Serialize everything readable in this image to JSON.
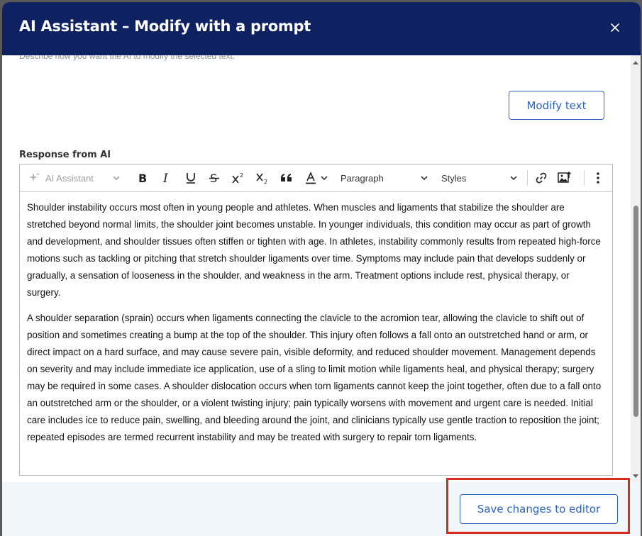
{
  "modal": {
    "title": "AI Assistant – Modify with a prompt",
    "hint": "Describe how you want the AI to modify the selected text.",
    "modify_button": "Modify text",
    "response_label": "Response from AI",
    "save_button": "Save changes to editor"
  },
  "toolbar": {
    "ai_assistant": "AI Assistant",
    "paragraph": "Paragraph",
    "styles": "Styles"
  },
  "content": {
    "paragraphs": [
      "Shoulder instability occurs most often in young people and athletes. When muscles and ligaments that stabilize the shoulder are stretched beyond normal limits, the shoulder joint becomes unstable. In younger individuals, this condition may occur as part of growth and development, and shoulder tissues often stiffen or tighten with age. In athletes, instability commonly results from re­peated high-force motions such as tackling or pitching that stretch shoulder ligaments over time. Symptoms may include pain that develops suddenly or gradually, a sensation of looseness in the shoulder, and weakness in the arm. Treatment options include rest, physical therapy, or surgery.",
      "A shoulder separation (sprain) occurs when ligaments connecting the clavicle to the acromion tear, allowing the clavicle to shift out of position and sometimes creating a bump at the top of the shoulder. This injury often follows a fall onto an outstretched hand or arm, or direct impact on a hard surface, and may cause severe pain, visible deformity, and reduced shoulder movement. Management depends on severity and may include immediate ice application, use of a sling to limit motion while ligaments heal, and physical therapy; surgery may be required in some cases. A shoulder dislocation occurs when torn ligaments cannot keep the joint together, often due to a fall onto an outstretched arm or the shoulder, or a violent twisting injury; pain typically worsens with movement and urgent care is needed. Initial care includes ice to reduce pain, swelling, and bleeding around the joint, and clinicians typically use gentle traction to reposition the joint; repeated episodes are termed recurrent instability and may be treated with sur­gery to repair torn ligaments."
    ]
  },
  "colors": {
    "header_bg": "#0e2160",
    "accent": "#2a63b8",
    "highlight": "#d82a1e"
  }
}
